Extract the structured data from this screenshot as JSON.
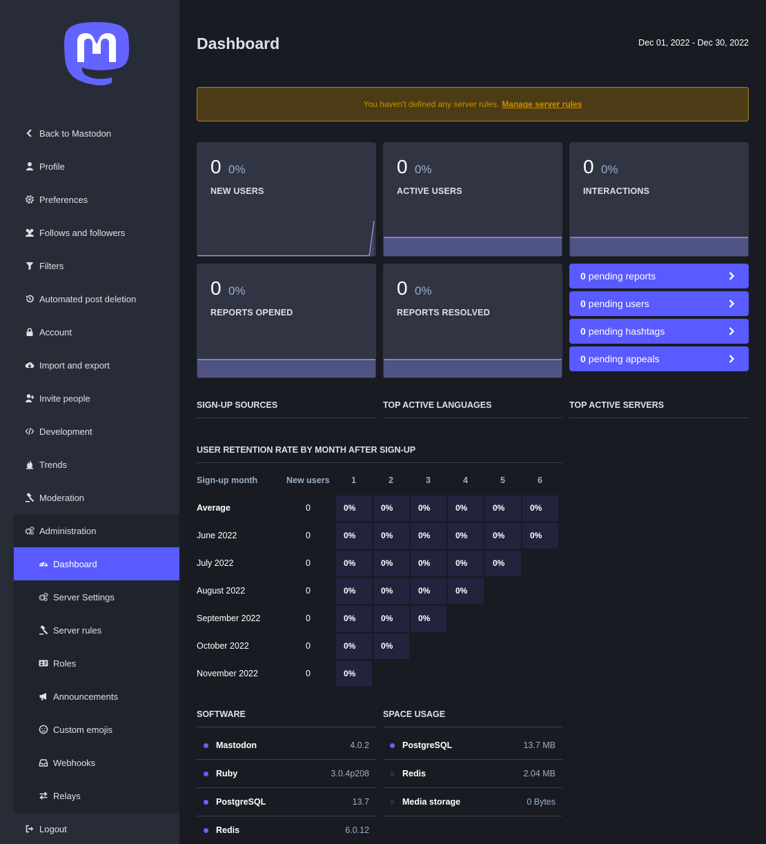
{
  "sidebar": {
    "logo_alt": "Mastodon",
    "items": [
      {
        "label": "Back to Mastodon",
        "icon": "chevron-left-icon"
      },
      {
        "label": "Profile",
        "icon": "user-icon"
      },
      {
        "label": "Preferences",
        "icon": "gear-icon"
      },
      {
        "label": "Follows and followers",
        "icon": "users-icon"
      },
      {
        "label": "Filters",
        "icon": "filter-icon"
      },
      {
        "label": "Automated post deletion",
        "icon": "history-icon"
      },
      {
        "label": "Account",
        "icon": "lock-icon"
      },
      {
        "label": "Import and export",
        "icon": "cloud-download-icon"
      },
      {
        "label": "Invite people",
        "icon": "user-plus-icon"
      },
      {
        "label": "Development",
        "icon": "code-icon"
      },
      {
        "label": "Trends",
        "icon": "fire-icon"
      },
      {
        "label": "Moderation",
        "icon": "gavel-icon"
      },
      {
        "label": "Administration",
        "icon": "cogs-icon"
      },
      {
        "label": "Dashboard",
        "icon": "tachometer-icon"
      },
      {
        "label": "Server Settings",
        "icon": "cogs-icon"
      },
      {
        "label": "Server rules",
        "icon": "gavel-icon"
      },
      {
        "label": "Roles",
        "icon": "id-card-icon"
      },
      {
        "label": "Announcements",
        "icon": "bullhorn-icon"
      },
      {
        "label": "Custom emojis",
        "icon": "smile-icon"
      },
      {
        "label": "Webhooks",
        "icon": "inbox-icon"
      },
      {
        "label": "Relays",
        "icon": "exchange-icon"
      },
      {
        "label": "Logout",
        "icon": "sign-out-icon"
      }
    ]
  },
  "header": {
    "title": "Dashboard",
    "date_range": "Dec 01, 2022 - Dec 30, 2022"
  },
  "warning": {
    "text": "You haven't defined any server rules.",
    "link": "Manage server rules"
  },
  "metrics": [
    {
      "value": "0",
      "change": "0%",
      "label": "NEW USERS"
    },
    {
      "value": "0",
      "change": "0%",
      "label": "ACTIVE USERS"
    },
    {
      "value": "0",
      "change": "0%",
      "label": "INTERACTIONS"
    },
    {
      "value": "0",
      "change": "0%",
      "label": "REPORTS OPENED"
    },
    {
      "value": "0",
      "change": "0%",
      "label": "REPORTS RESOLVED"
    }
  ],
  "pending": [
    {
      "count": "0",
      "label": "pending reports"
    },
    {
      "count": "0",
      "label": "pending users"
    },
    {
      "count": "0",
      "label": "pending hashtags"
    },
    {
      "count": "0",
      "label": "pending appeals"
    }
  ],
  "sections": {
    "signup_sources": "SIGN-UP SOURCES",
    "top_languages": "TOP ACTIVE LANGUAGES",
    "top_servers": "TOP ACTIVE SERVERS",
    "retention": "USER RETENTION RATE BY MONTH AFTER SIGN-UP",
    "software": "SOFTWARE",
    "space": "SPACE USAGE"
  },
  "retention": {
    "headers": [
      "Sign-up month",
      "New users",
      "1",
      "2",
      "3",
      "4",
      "5",
      "6"
    ],
    "rows": [
      {
        "month": "Average",
        "new": "0",
        "cells": [
          "0%",
          "0%",
          "0%",
          "0%",
          "0%",
          "0%"
        ]
      },
      {
        "month": "June 2022",
        "new": "0",
        "cells": [
          "0%",
          "0%",
          "0%",
          "0%",
          "0%",
          "0%"
        ]
      },
      {
        "month": "July 2022",
        "new": "0",
        "cells": [
          "0%",
          "0%",
          "0%",
          "0%",
          "0%"
        ]
      },
      {
        "month": "August 2022",
        "new": "0",
        "cells": [
          "0%",
          "0%",
          "0%",
          "0%"
        ]
      },
      {
        "month": "September 2022",
        "new": "0",
        "cells": [
          "0%",
          "0%",
          "0%"
        ]
      },
      {
        "month": "October 2022",
        "new": "0",
        "cells": [
          "0%",
          "0%"
        ]
      },
      {
        "month": "November 2022",
        "new": "0",
        "cells": [
          "0%"
        ]
      }
    ]
  },
  "software": [
    {
      "name": "Mastodon",
      "value": "4.0.2"
    },
    {
      "name": "Ruby",
      "value": "3.0.4p208"
    },
    {
      "name": "PostgreSQL",
      "value": "13.7"
    },
    {
      "name": "Redis",
      "value": "6.0.12"
    }
  ],
  "space": [
    {
      "name": "PostgreSQL",
      "value": "13.7 MB"
    },
    {
      "name": "Redis",
      "value": "2.04 MB"
    },
    {
      "name": "Media storage",
      "value": "0 Bytes"
    }
  ],
  "colors": {
    "accent": "#595aff",
    "sidebar": "#282c37",
    "background": "#191b22",
    "card": "#313543",
    "warning_bg": "#4c3c15",
    "warning_text": "#ca8f04"
  }
}
